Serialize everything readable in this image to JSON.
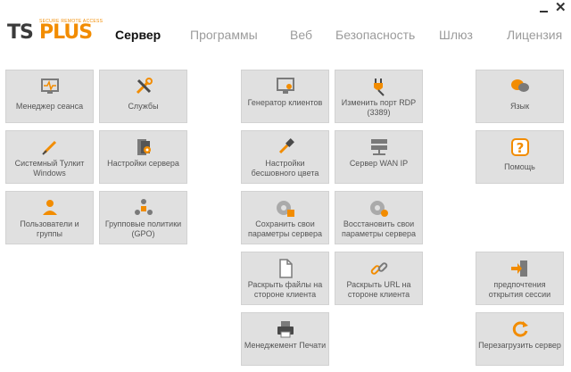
{
  "window": {
    "minimize_label": "_",
    "close_label": "✕"
  },
  "logo": {
    "ts": "TS",
    "plus": "PLUS",
    "tagline": "SECURE REMOTE ACCESS"
  },
  "nav": [
    {
      "label": "Сервер",
      "active": true
    },
    {
      "label": "Программы",
      "active": false
    },
    {
      "label": "Веб",
      "active": false
    },
    {
      "label": "Безопасность",
      "active": false
    },
    {
      "label": "Шлюз",
      "active": false
    },
    {
      "label": "Лицензия",
      "active": false
    }
  ],
  "tiles": {
    "session_manager": "Менеджер сеанса",
    "services": "Службы",
    "system_toolkit": "Системный Тулкит Windows",
    "server_settings": "Настройки сервера",
    "users_groups": "Пользователи и группы",
    "group_policy": "Групповые политики (GPO)",
    "client_generator": "Генератор клиентов",
    "change_rdp_port": "Изменить порт RDP (3389)",
    "language": "Язык",
    "seamless_settings": "Настройки бесшовного цвета",
    "wan_ip": "Сервер WAN IP",
    "help": "Помощь",
    "save_settings": "Сохранить свои параметры сервера",
    "restore_settings": "Восстановить свои параметры сервера",
    "open_files": "Раскрыть файлы на стороне клиента",
    "open_url": "Раскрыть URL на стороне клиента",
    "session_opening": "предпочтения открытия сессии",
    "print_management": "Менеджемент Печати",
    "restart_server": "Перезагрузить сервер"
  },
  "colors": {
    "accent": "#f28c00",
    "tile_bg": "#e0e0e0",
    "icon_gray": "#7a7a7a"
  }
}
